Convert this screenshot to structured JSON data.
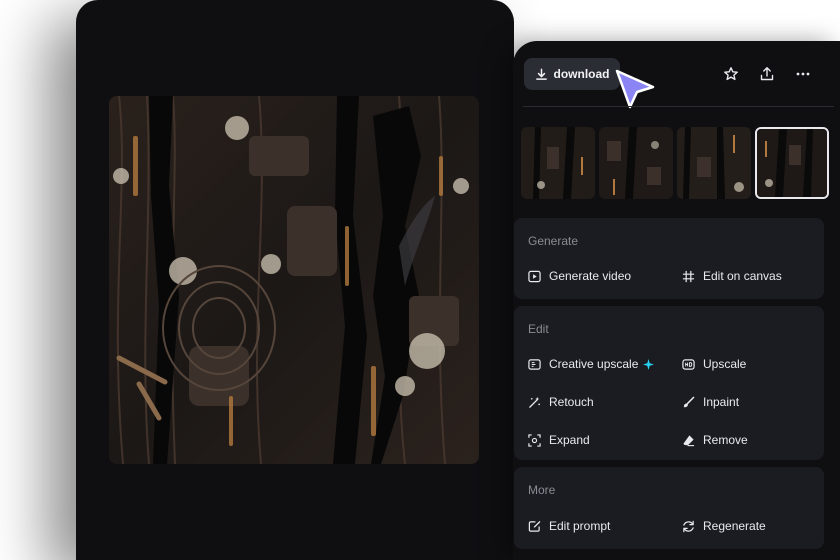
{
  "toolbar": {
    "download_label": "download",
    "icons": [
      "download-icon",
      "star-icon",
      "share-icon",
      "more-icon"
    ]
  },
  "colors": {
    "background": "#0f0f12",
    "card": "#1b1c22",
    "button": "#2b2d35",
    "cursor": "#8a84f4",
    "sparkle": "#27d3f2"
  },
  "sections": {
    "generate": {
      "title": "Generate",
      "generate_video": "Generate video",
      "edit_on_canvas": "Edit on canvas"
    },
    "edit": {
      "title": "Edit",
      "creative_upscale": "Creative upscale",
      "upscale": "Upscale",
      "retouch": "Retouch",
      "inpaint": "Inpaint",
      "expand": "Expand",
      "remove": "Remove"
    },
    "more": {
      "title": "More",
      "edit_prompt": "Edit prompt",
      "regenerate": "Regenerate"
    }
  }
}
